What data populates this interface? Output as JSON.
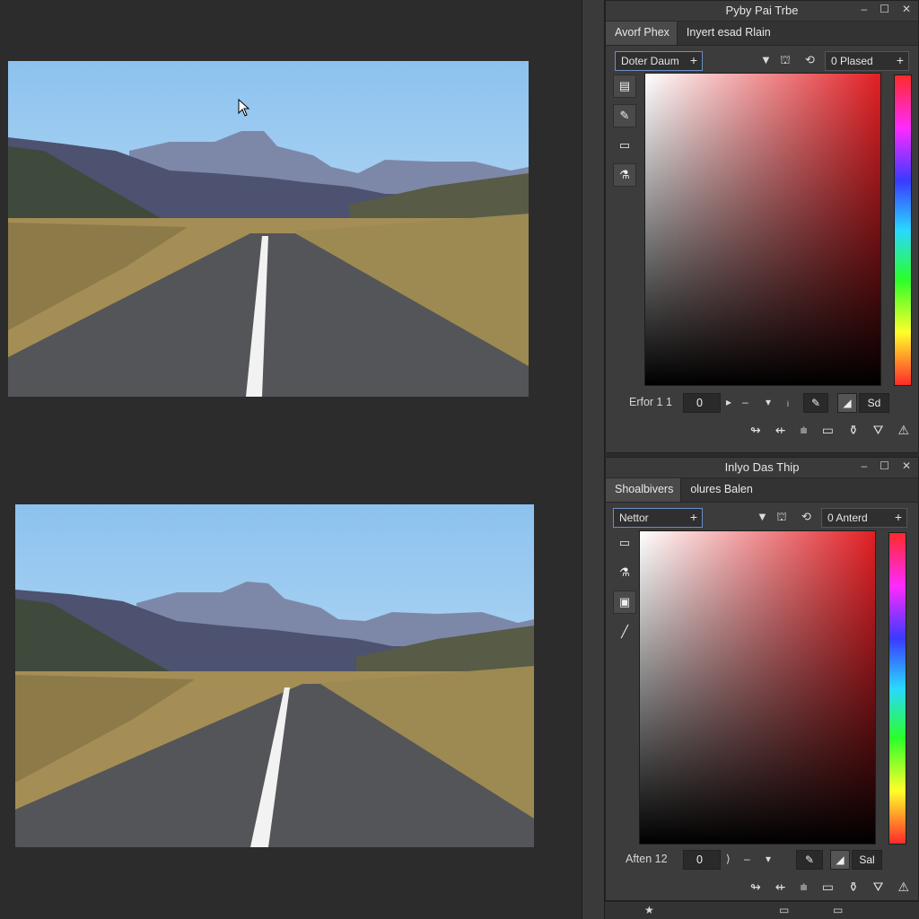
{
  "panels": [
    {
      "title": "Pyby Pai Trbe",
      "window_controls": [
        "–",
        "☐",
        "✕"
      ],
      "tabs": [
        {
          "label": "Avorf Phex"
        },
        {
          "label": "Inyert esad Rlain"
        }
      ],
      "dropdown": {
        "label": "Doter Daum",
        "plus": "+"
      },
      "right_field": {
        "label": "0  Plased",
        "plus": "+"
      },
      "toolbar_glyphs": [
        "▼",
        "⛫",
        "⟲"
      ],
      "tools": [
        "▤",
        "✎",
        "▭",
        "⚗"
      ],
      "value_row": {
        "label": "Erfor 1 1",
        "value": "0",
        "glyphs": [
          "▸",
          "–",
          "▾",
          "ᵢ"
        ],
        "button": "Sd"
      },
      "bottom_icons": [
        "↬",
        "⇷",
        "⩧",
        "▭",
        "⚱",
        "⛛",
        "⚠"
      ]
    },
    {
      "title": "Inlyo Das Thip",
      "window_controls": [
        "–",
        "☐",
        "✕"
      ],
      "tabs": [
        {
          "label": "Shoalbivers"
        },
        {
          "label": "olures Balen"
        }
      ],
      "dropdown": {
        "label": "Nettor",
        "plus": "+"
      },
      "right_field": {
        "label": "0  Anterd",
        "plus": "+"
      },
      "toolbar_glyphs": [
        "▼",
        "⛫",
        "⟲"
      ],
      "tools": [
        "▭",
        "⚗",
        "▣",
        "╱"
      ],
      "value_row": {
        "label": "Aften 12",
        "value": "0",
        "glyphs": [
          "⟩",
          "–",
          "▾"
        ],
        "button": "Sal"
      },
      "bottom_icons": [
        "↬",
        "⇷",
        "⩧",
        "▭",
        "⚱",
        "⛛",
        "⚠"
      ]
    }
  ],
  "footer_glyphs": [
    "★",
    "▭",
    "▭"
  ]
}
